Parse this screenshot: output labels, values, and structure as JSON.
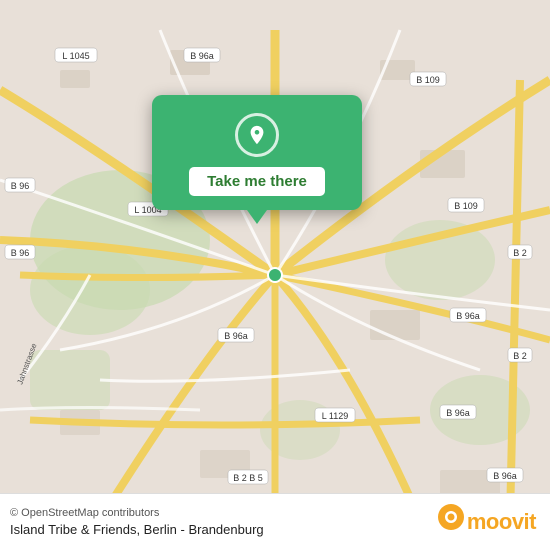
{
  "map": {
    "attribution": "© OpenStreetMap contributors",
    "venue": "Island Tribe & Friends, Berlin - Brandenburg",
    "road_labels": [
      "L 1045",
      "B 96a",
      "B 96",
      "B 96",
      "L 1004",
      "B 109",
      "B 109",
      "B 2",
      "B 2",
      "B 96a",
      "B 96a",
      "B 96a",
      "L 1129",
      "B 2 B 5"
    ],
    "bg_color": "#e8e0d8"
  },
  "popup": {
    "button_label": "Take me there",
    "bg_color": "#3cb371"
  },
  "moovit": {
    "wordmark": "moovit"
  }
}
